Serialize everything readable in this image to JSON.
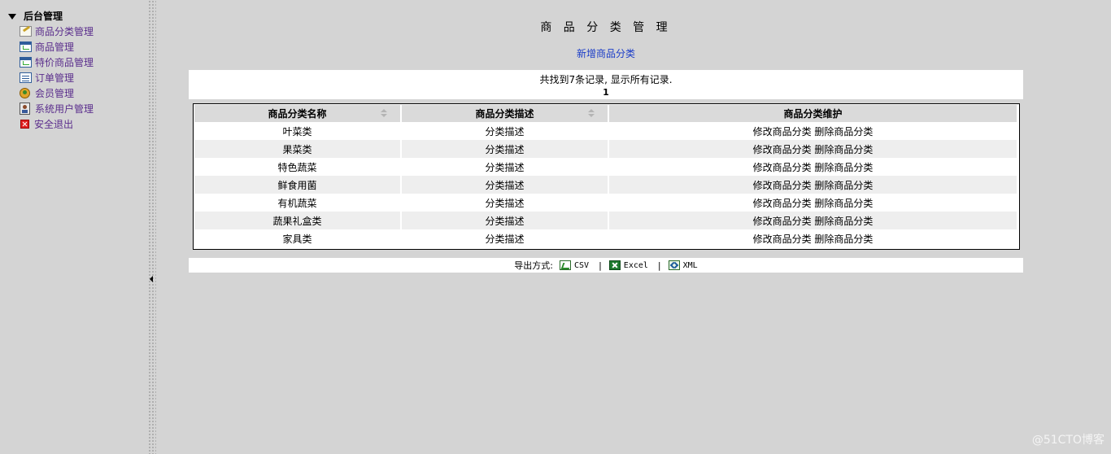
{
  "sidebar": {
    "root_label": "后台管理",
    "items": [
      {
        "label": "商品分类管理",
        "icon": "edit-icon"
      },
      {
        "label": "商品管理",
        "icon": "chart-window-icon"
      },
      {
        "label": "特价商品管理",
        "icon": "chart-window-icon"
      },
      {
        "label": "订单管理",
        "icon": "list-window-icon"
      },
      {
        "label": "会员管理",
        "icon": "users-icon"
      },
      {
        "label": "系统用户管理",
        "icon": "user-card-icon"
      },
      {
        "label": "安全退出",
        "icon": "exit-icon"
      }
    ]
  },
  "main": {
    "title": "商 品 分 类 管 理",
    "add_link": "新增商品分类",
    "info_text": "共找到7条记录, 显示所有记录.",
    "page_number": "1",
    "table": {
      "headers": [
        "商品分类名称",
        "商品分类描述",
        "商品分类维护"
      ],
      "rows": [
        {
          "name": "叶菜类",
          "desc": "分类描述",
          "edit": "修改商品分类",
          "delete": "删除商品分类"
        },
        {
          "name": "果菜类",
          "desc": "分类描述",
          "edit": "修改商品分类",
          "delete": "删除商品分类"
        },
        {
          "name": "特色蔬菜",
          "desc": "分类描述",
          "edit": "修改商品分类",
          "delete": "删除商品分类"
        },
        {
          "name": "鲜食用菌",
          "desc": "分类描述",
          "edit": "修改商品分类",
          "delete": "删除商品分类"
        },
        {
          "name": "有机蔬菜",
          "desc": "分类描述",
          "edit": "修改商品分类",
          "delete": "删除商品分类"
        },
        {
          "name": "蔬果礼盒类",
          "desc": "分类描述",
          "edit": "修改商品分类",
          "delete": "删除商品分类"
        },
        {
          "name": "家具类",
          "desc": "分类描述",
          "edit": "修改商品分类",
          "delete": "删除商品分类"
        }
      ]
    },
    "export": {
      "label": "导出方式:",
      "csv": "CSV",
      "excel": "Excel",
      "xml": "XML",
      "separator": "|"
    }
  },
  "watermark": "@51CTO博客",
  "colors": {
    "background": "#d4d4d4",
    "menu_link": "#5a2d8c",
    "add_link": "#1a3cc8",
    "header_bg": "#dadada",
    "alt_row": "#eeeeee"
  }
}
